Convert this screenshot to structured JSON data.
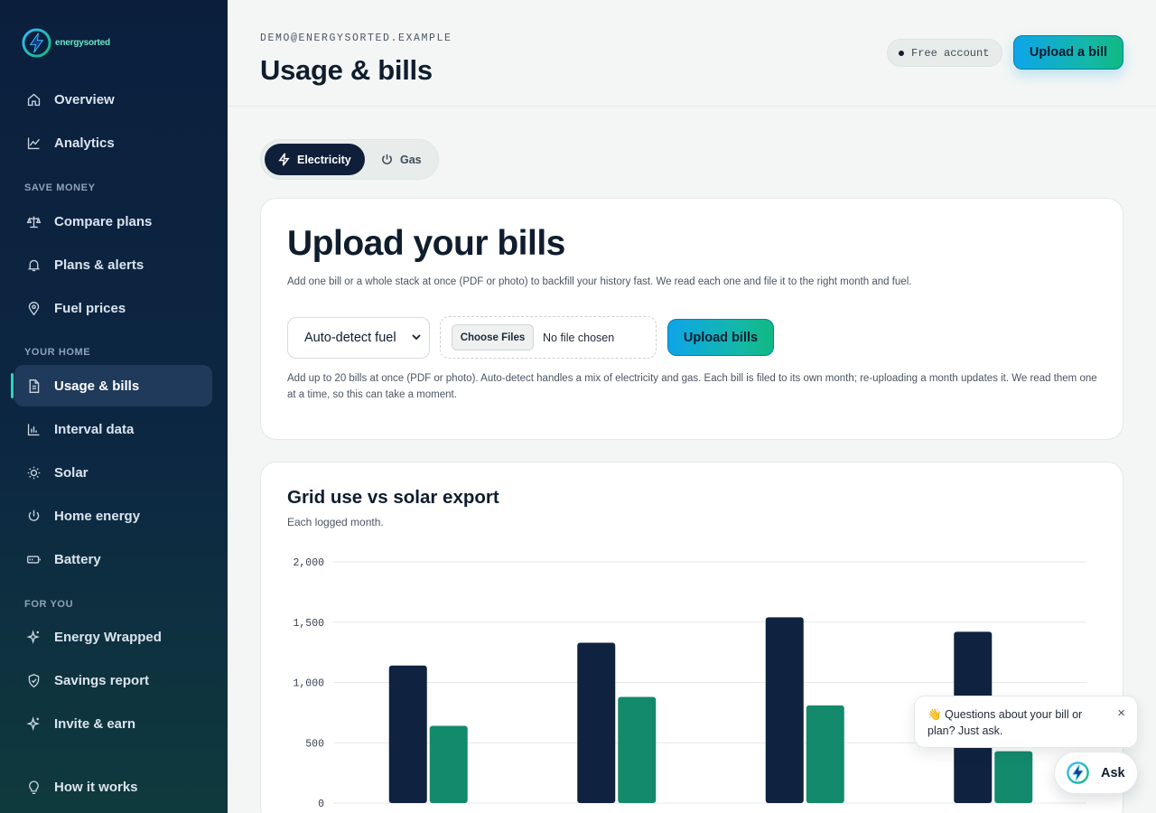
{
  "brand": {
    "name": "energysorted"
  },
  "sidebar": {
    "top_items": [
      {
        "label": "Overview",
        "icon": "home-icon"
      },
      {
        "label": "Analytics",
        "icon": "analytics-icon"
      }
    ],
    "sections": [
      {
        "title": "SAVE MONEY",
        "items": [
          {
            "label": "Compare plans",
            "icon": "scale-icon"
          },
          {
            "label": "Plans & alerts",
            "icon": "bell-icon"
          },
          {
            "label": "Fuel prices",
            "icon": "map-pin-icon"
          }
        ]
      },
      {
        "title": "YOUR HOME",
        "items": [
          {
            "label": "Usage & bills",
            "icon": "document-icon",
            "active": true
          },
          {
            "label": "Interval data",
            "icon": "bar-chart-icon"
          },
          {
            "label": "Solar",
            "icon": "sun-icon"
          },
          {
            "label": "Home energy",
            "icon": "power-icon"
          },
          {
            "label": "Battery",
            "icon": "battery-icon"
          }
        ]
      },
      {
        "title": "FOR YOU",
        "items": [
          {
            "label": "Energy Wrapped",
            "icon": "sparkle-icon"
          },
          {
            "label": "Savings report",
            "icon": "shield-check-icon"
          },
          {
            "label": "Invite & earn",
            "icon": "sparkle-icon"
          }
        ]
      }
    ],
    "footer_item": {
      "label": "How it works",
      "icon": "lightbulb-icon"
    }
  },
  "header": {
    "user_email": "DEMO@ENERGYSORTED.EXAMPLE",
    "title": "Usage & bills",
    "account_label": "Free account",
    "upload_button": "Upload a bill"
  },
  "fuel_toggle": {
    "options": [
      {
        "label": "Electricity",
        "icon": "bolt-icon",
        "selected": true
      },
      {
        "label": "Gas",
        "icon": "power-icon",
        "selected": false
      }
    ]
  },
  "upload": {
    "title": "Upload your bills",
    "description": "Add one bill or a whole stack at once (PDF or photo) to backfill your history fast. We read each one and file it to the right month and fuel.",
    "fuel_select_value": "Auto-detect fuel",
    "choose_files_label": "Choose Files",
    "no_file_label": "No file chosen",
    "upload_button": "Upload bills",
    "help_text": "Add up to 20 bills at once (PDF or photo). Auto-detect handles a mix of electricity and gas. Each bill is filed to its own month; re-uploading a month updates it. We read them one at a time, so this can take a moment."
  },
  "chart": {
    "title": "Grid use vs solar export",
    "subtitle": "Each logged month."
  },
  "chart_data": {
    "type": "bar",
    "title": "Grid use vs solar export",
    "subtitle": "Each logged month.",
    "categories": [
      "",
      "",
      "",
      ""
    ],
    "series": [
      {
        "values": [
          1140,
          1330,
          1540,
          1420
        ],
        "color": "#0f2340"
      },
      {
        "values": [
          640,
          880,
          810,
          430
        ],
        "color": "#138a6c"
      }
    ],
    "yticks": [
      "0",
      "500",
      "1,000",
      "1,500",
      "2,000"
    ],
    "ylim": [
      0,
      2000
    ],
    "grid": true
  },
  "chat": {
    "message": "👋 Questions about your bill or plan? Just ask.",
    "close_label": "×",
    "ask_label": "Ask"
  }
}
